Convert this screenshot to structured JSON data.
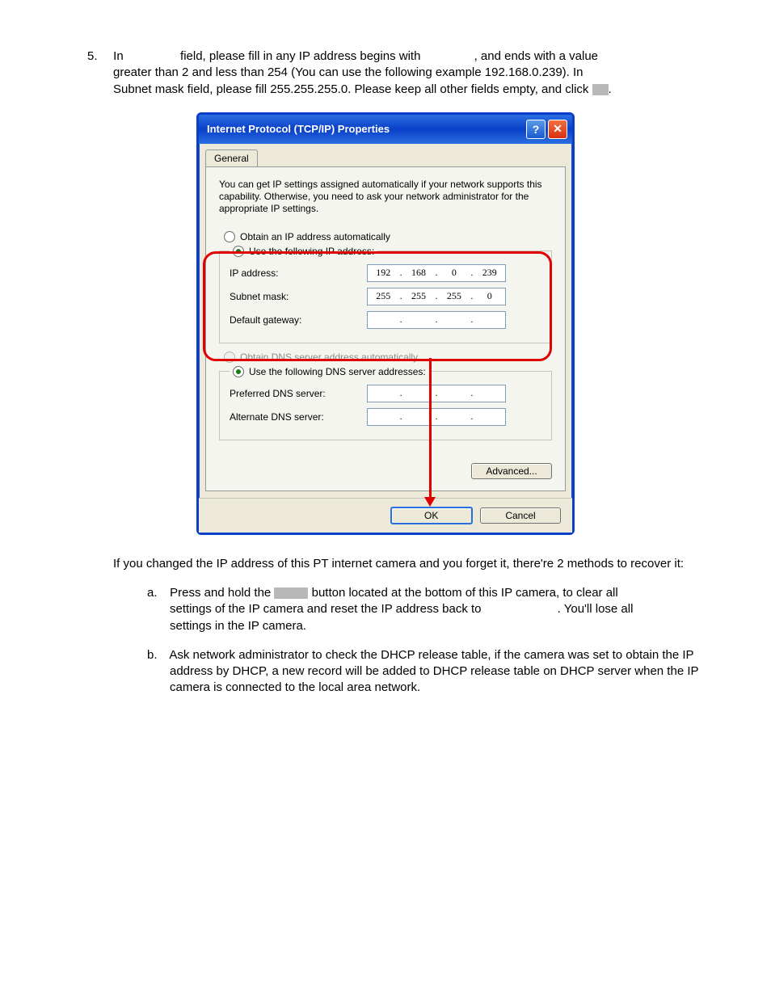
{
  "step": {
    "number": "5.",
    "line1a": "In ",
    "line1b": " field, please fill in any IP address begins with ",
    "line1c": ", and ends with a value",
    "line2": "greater than 2 and less than 254 (You can use the following example 192.168.0.239). In",
    "line3a": "Subnet mask field, please fill 255.255.255.0. Please keep all other fields empty, and click ",
    "line3b": "."
  },
  "dialog": {
    "title": "Internet Protocol (TCP/IP) Properties",
    "help": "?",
    "close": "✕",
    "tab": "General",
    "description": "You can get IP settings assigned automatically if your network supports this capability. Otherwise, you need to ask your network administrator for the appropriate IP settings.",
    "radio_auto_ip": "Obtain an IP address automatically",
    "radio_manual_ip": "Use the following IP address:",
    "lbl_ip": "IP address:",
    "lbl_subnet": "Subnet mask:",
    "lbl_gateway": "Default gateway:",
    "ip": [
      "192",
      "168",
      "0",
      "239"
    ],
    "subnet": [
      "255",
      "255",
      "255",
      "0"
    ],
    "gateway": [
      "",
      "",
      "",
      ""
    ],
    "radio_auto_dns": "Obtain DNS server address automatically",
    "radio_manual_dns": "Use the following DNS server addresses:",
    "lbl_pref_dns": "Preferred DNS server:",
    "lbl_alt_dns": "Alternate DNS server:",
    "pref_dns": [
      "",
      "",
      "",
      ""
    ],
    "alt_dns": [
      "",
      "",
      "",
      ""
    ],
    "advanced": "Advanced...",
    "ok": "OK",
    "cancel": "Cancel"
  },
  "followup": "If you changed the IP address of this PT internet camera and you forget it, there're 2 methods to recover it:",
  "sub_a": {
    "letter": "a.",
    "t1": "Press and hold the ",
    "t2": " button located at the bottom of this IP camera, to clear all",
    "t3": "settings of the IP camera and reset the IP address back to ",
    "t4": ". You'll lose all",
    "t5": "settings in the IP camera."
  },
  "sub_b": {
    "letter": "b.",
    "text": "Ask network administrator to check the DHCP release table, if the camera was set to obtain the IP address by DHCP, a new record will be added to DHCP release table on DHCP server when the IP camera is connected to the local area network."
  }
}
